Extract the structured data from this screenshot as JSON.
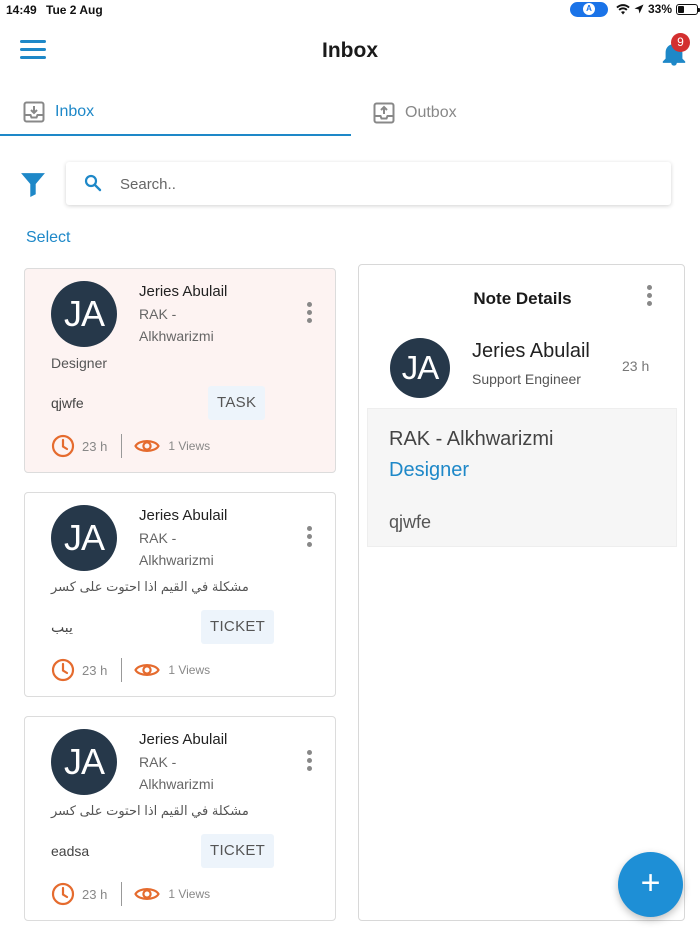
{
  "status_bar": {
    "time": "14:49",
    "date": "Tue 2 Aug",
    "battery": "33%",
    "battery_level": 0.33
  },
  "header": {
    "title": "Inbox",
    "notification_count": "9"
  },
  "tabs": [
    {
      "label": "Inbox",
      "active": true
    },
    {
      "label": "Outbox",
      "active": false
    }
  ],
  "search": {
    "placeholder": "Search..",
    "value": ""
  },
  "select_label": "Select",
  "colors": {
    "accent": "#1e88c8",
    "avatar": "#26384a",
    "clock": "#e56b2e",
    "badge": "#d32f2f"
  },
  "messages": [
    {
      "initials": "JA",
      "name": "Jeries Abulail",
      "org_line1": "RAK -",
      "org_line2": "Alkhwarizmi",
      "role": "Designer",
      "body": "qjwfe",
      "tag": "TASK",
      "time": "23 h",
      "views": "1 Views",
      "selected": true
    },
    {
      "initials": "JA",
      "name": "Jeries Abulail",
      "org_line1": "RAK -",
      "org_line2": "Alkhwarizmi",
      "role": "مشكلة في القيم اذا احتوت على كسر",
      "body": "يبب",
      "tag": "TICKET",
      "time": "23 h",
      "views": "1 Views",
      "selected": false
    },
    {
      "initials": "JA",
      "name": "Jeries Abulail",
      "org_line1": "RAK -",
      "org_line2": "Alkhwarizmi",
      "role": "مشكلة في القيم اذا احتوت على كسر",
      "body": "eadsa",
      "tag": "TICKET",
      "time": "23 h",
      "views": "1 Views",
      "selected": false
    }
  ],
  "note_details": {
    "title": "Note Details",
    "initials": "JA",
    "name": "Jeries Abulail",
    "role": "Support Engineer",
    "time": "23 h",
    "org": "RAK - Alkhwarizmi",
    "tag": "Designer",
    "body": "qjwfe"
  },
  "fab_label": "+"
}
